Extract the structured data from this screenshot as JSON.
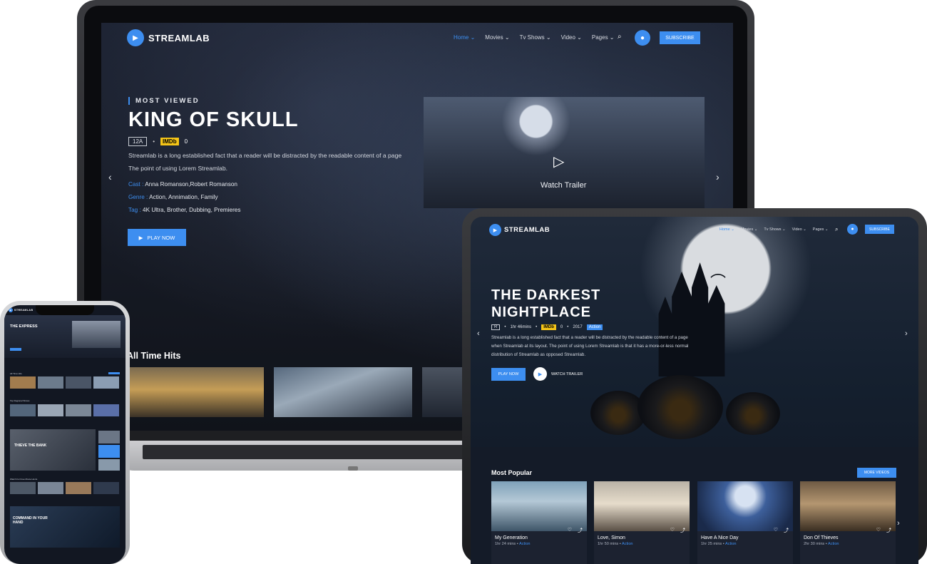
{
  "laptop": {
    "brand": "STREAMLAB",
    "nav": {
      "items": [
        "Home",
        "Movies",
        "Tv Shows",
        "Video",
        "Pages"
      ],
      "subscribe": "SUBSCRIBE"
    },
    "hero": {
      "label": "MOST VIEWED",
      "title": "KING OF SKULL",
      "rating": "12A",
      "imdb": "IMDb",
      "imdb_score": "0",
      "desc_line1": "Streamlab is a long established fact that a reader will be distracted by the readable content of a page",
      "desc_line2": "The point of using Lorem Streamlab.",
      "cast_key": "Cast :",
      "cast_val": "Anna Romanson,Robert Romanson",
      "genre_key": "Genre :",
      "genre_val": "Action, Annimation, Family",
      "tag_key": "Tag :",
      "tag_val": "4K Ultra, Brother, Dubbing, Premieres",
      "play": "PLAY NOW",
      "trailer": "Watch Trailer"
    },
    "section_title": "All Time Hits"
  },
  "tablet": {
    "brand": "STREAMLAB",
    "nav": {
      "items": [
        "Home",
        "Movies",
        "Tv Shows",
        "Video",
        "Pages"
      ],
      "subscribe": "SUBSCRIBE"
    },
    "hero": {
      "title_line1": "THE DARKEST",
      "title_line2": "NIGHTPLACE",
      "rating": "R",
      "duration": "1hr 46mins",
      "imdb": "IMDb",
      "imdb_score": "0",
      "year": "2017",
      "genre": "Action",
      "desc_line1": "Streamlab is a long established fact that a reader will be distracted by the readable content of a page",
      "desc_line2": "when Streamlab at its layout. The point of using Lorem Streamlab is that it has a more-or-less normal",
      "desc_line3": "distribution of Streamlab as opposed Streamlab.",
      "play": "PLAY NOW",
      "trailer": "WATCH TRAILER"
    },
    "popular": {
      "title": "Most Popular",
      "more": "MORE VIDEOS",
      "cards": [
        {
          "title": "My Generation",
          "duration": "1hr 24 mins",
          "genre": "Action"
        },
        {
          "title": "Love, Simon",
          "duration": "1hr 50 mins",
          "genre": "Action"
        },
        {
          "title": "Have A Nice Day",
          "duration": "1hr 25 mins",
          "genre": "Action"
        },
        {
          "title": "Don Of Thieves",
          "duration": "2hr 30 mins",
          "genre": "Action"
        }
      ]
    }
  },
  "phone": {
    "brand": "STREAMLAB",
    "hero_title": "THE EXPRESS",
    "sections": [
      "All Time Hits",
      "Top Regional Shows"
    ],
    "feature1": "THIEVE THE BANK",
    "section3": "Watch For Free Movie Hunts",
    "feature2_line1": "COMMAND IN YOUR",
    "feature2_line2": "HAND"
  },
  "colors": {
    "accent": "#3d8ef0",
    "imdb": "#f5c518",
    "background_dark": "#161a24"
  }
}
